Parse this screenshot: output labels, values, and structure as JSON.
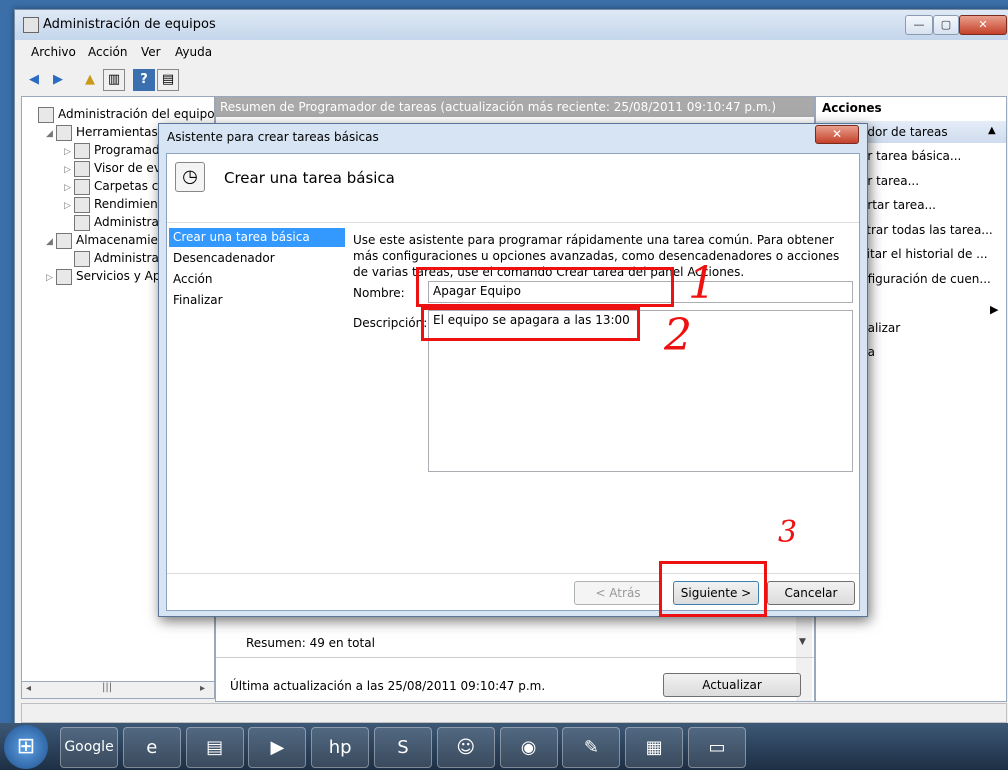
{
  "window": {
    "title": "Administración de equipos",
    "menu": [
      "Archivo",
      "Acción",
      "Ver",
      "Ayuda"
    ],
    "caption_buttons": [
      "—",
      "▢",
      "✕"
    ]
  },
  "tree": {
    "items": [
      {
        "label": "Administración del equipo (loc",
        "icon": "computer-icon",
        "indent": 0,
        "arrow": ""
      },
      {
        "label": "Herramientas del sistema",
        "icon": "tools-icon",
        "indent": 1,
        "arrow": "◢"
      },
      {
        "label": "Programador",
        "icon": "clock-icon",
        "indent": 2,
        "arrow": "▷"
      },
      {
        "label": "Visor de event",
        "icon": "event-viewer-icon",
        "indent": 2,
        "arrow": "▷"
      },
      {
        "label": "Carpetas com",
        "icon": "shared-folder-icon",
        "indent": 2,
        "arrow": "▷"
      },
      {
        "label": "Rendimiento",
        "icon": "performance-icon",
        "indent": 2,
        "arrow": "▷"
      },
      {
        "label": "Administrado",
        "icon": "device-manager-icon",
        "indent": 2,
        "arrow": ""
      },
      {
        "label": "Almacenamiento",
        "icon": "storage-icon",
        "indent": 1,
        "arrow": "◢"
      },
      {
        "label": "Administració",
        "icon": "disk-icon",
        "indent": 2,
        "arrow": ""
      },
      {
        "label": "Servicios y Aplica",
        "icon": "services-icon",
        "indent": 1,
        "arrow": "▷"
      }
    ]
  },
  "center": {
    "summary_header": "Resumen de Programador de tareas (actualización más reciente: 25/08/2011 09:10:47 p.m.)",
    "summary_total": "Resumen: 49 en total",
    "last_update": "Última actualización a las 25/08/2011 09:10:47 p.m.",
    "refresh_button": "Actualizar"
  },
  "actions": {
    "header": "Acciones",
    "section": "ador de tareas",
    "items": [
      "ar tarea básica...",
      "ar tarea...",
      "ortar tarea...",
      "strar todas las tarea...",
      "ilitar el historial de ...",
      "nfiguración de cuen...",
      "",
      "ualizar",
      "da"
    ]
  },
  "dialog": {
    "title": "Asistente para crear tareas básicas",
    "close": "✕",
    "heading": "Crear una tarea básica",
    "steps": [
      "Crear una tarea básica",
      "Desencadenador",
      "Acción",
      "Finalizar"
    ],
    "intro": "Use este asistente para programar rápidamente una tarea común. Para obtener más configuraciones u opciones avanzadas, como desencadenadores o acciones de varias tareas, use el comando Crear tarea del panel Acciones.",
    "name_label": "Nombre:",
    "name_value": "Apagar Equipo",
    "description_label": "Descripción:",
    "description_value": "El equipo se apagara a las 13:00",
    "back_button": "< Atrás",
    "next_button": "Siguiente >",
    "cancel_button": "Cancelar"
  },
  "annotations": [
    "1",
    "2",
    "3"
  ],
  "taskbar": {
    "start": "⊞",
    "apps": [
      {
        "name": "google-app",
        "label": "Google"
      },
      {
        "name": "ie-app",
        "label": "e"
      },
      {
        "name": "explorer-app",
        "label": "▤"
      },
      {
        "name": "media-player-app",
        "label": "▶"
      },
      {
        "name": "hp-app",
        "label": "hp"
      },
      {
        "name": "skype-app",
        "label": "S"
      },
      {
        "name": "users-app",
        "label": "☺"
      },
      {
        "name": "chrome-app",
        "label": "◉"
      },
      {
        "name": "paint-app",
        "label": "✎"
      },
      {
        "name": "computer-mgmt-app",
        "label": "▦"
      },
      {
        "name": "notepad-app",
        "label": "▭"
      }
    ]
  }
}
